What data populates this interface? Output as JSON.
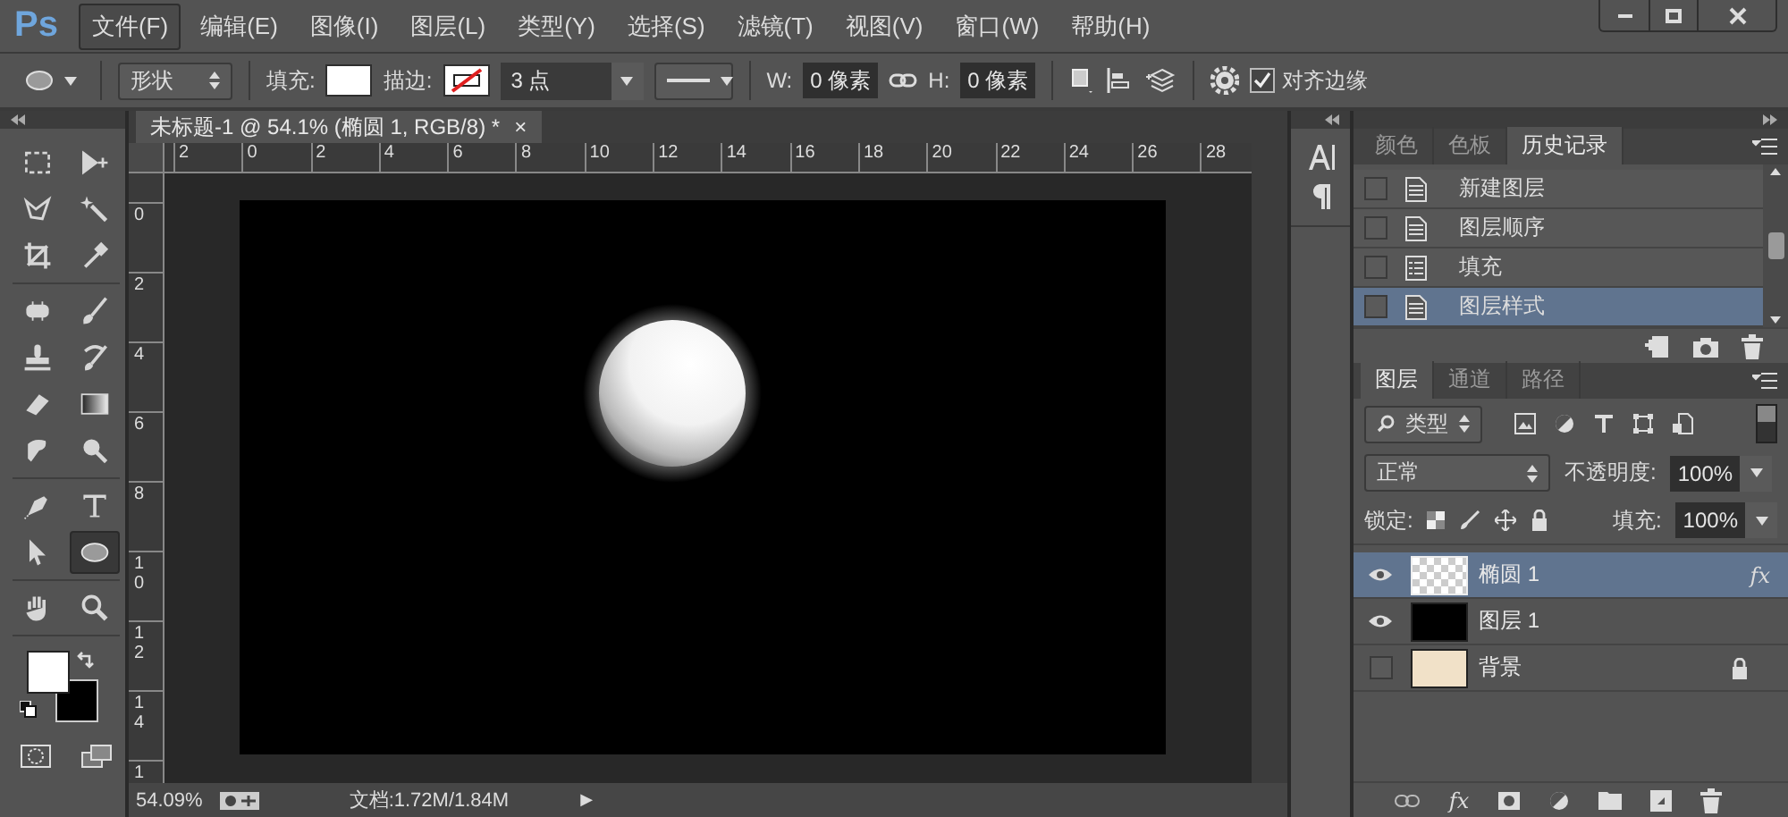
{
  "menu_bar": {
    "logo": "Ps",
    "items": [
      {
        "label": "文件(F)",
        "selected": true
      },
      {
        "label": "编辑(E)",
        "selected": false
      },
      {
        "label": "图像(I)",
        "selected": false
      },
      {
        "label": "图层(L)",
        "selected": false
      },
      {
        "label": "类型(Y)",
        "selected": false
      },
      {
        "label": "选择(S)",
        "selected": false
      },
      {
        "label": "滤镜(T)",
        "selected": false
      },
      {
        "label": "视图(V)",
        "selected": false
      },
      {
        "label": "窗口(W)",
        "selected": false
      },
      {
        "label": "帮助(H)",
        "selected": false
      }
    ]
  },
  "options_bar": {
    "mode": "形状",
    "fill_label": "填充:",
    "stroke_label": "描边:",
    "stroke_width": "3 点",
    "w_label": "W:",
    "w_value": "0 像素",
    "h_label": "H:",
    "h_value": "0 像素",
    "align_edges": {
      "label": "对齐边缘",
      "checked": true
    }
  },
  "toolbox": {
    "groups": [
      {
        "tools": [
          {
            "kind": "marquee",
            "selected": false
          },
          {
            "kind": "move",
            "selected": false
          },
          {
            "kind": "lasso",
            "selected": false
          },
          {
            "kind": "wand",
            "selected": false
          },
          {
            "kind": "crop",
            "selected": false
          },
          {
            "kind": "eyedropper",
            "selected": false
          }
        ]
      },
      {
        "tools": [
          {
            "kind": "healing",
            "selected": false
          },
          {
            "kind": "brush",
            "selected": false
          },
          {
            "kind": "stamp",
            "selected": false
          },
          {
            "kind": "history",
            "selected": false
          },
          {
            "kind": "eraser",
            "selected": false
          },
          {
            "kind": "gradient",
            "selected": false
          },
          {
            "kind": "smudge",
            "selected": false
          },
          {
            "kind": "dodge",
            "selected": false
          }
        ]
      },
      {
        "tools": [
          {
            "kind": "pen",
            "selected": false
          },
          {
            "kind": "type",
            "selected": false
          },
          {
            "kind": "select",
            "selected": false
          },
          {
            "kind": "ellipse",
            "selected": true
          }
        ]
      },
      {
        "tools": [
          {
            "kind": "hand",
            "selected": false
          },
          {
            "kind": "zoom",
            "selected": false
          }
        ]
      }
    ]
  },
  "document": {
    "title": "未标题-1 @ 54.1% (椭圆 1, RGB/8) *",
    "close": "×",
    "ruler_h": [
      "2",
      "0",
      "2",
      "4",
      "6",
      "8",
      "10",
      "12",
      "14",
      "16",
      "18",
      "20",
      "22",
      "24",
      "26",
      "28"
    ],
    "ruler_v": [
      "0",
      "2",
      "4",
      "6",
      "8",
      "10",
      "12",
      "14",
      "1"
    ],
    "zoom": "54.09%",
    "doc_info": "文档:1.72M/1.84M",
    "menu_arrow": "▶"
  },
  "history_panel": {
    "tabs": [
      {
        "label": "颜色",
        "selected": false
      },
      {
        "label": "色板",
        "selected": false
      },
      {
        "label": "历史记录",
        "selected": true
      }
    ],
    "items": [
      {
        "label": "新建图层",
        "kind": "document",
        "selected": false
      },
      {
        "label": "图层顺序",
        "kind": "document",
        "selected": false
      },
      {
        "label": "填充",
        "kind": "list",
        "selected": false
      },
      {
        "label": "图层样式",
        "kind": "document",
        "selected": true
      }
    ]
  },
  "layers_panel": {
    "tabs": [
      {
        "label": "图层",
        "selected": true
      },
      {
        "label": "通道",
        "selected": false
      },
      {
        "label": "路径",
        "selected": false
      }
    ],
    "filter": "类型",
    "blend_mode": "正常",
    "opacity_label": "不透明度:",
    "opacity": "100%",
    "lock_label": "锁定:",
    "fill_label": "填充:",
    "fill": "100%",
    "footer_fx": "fx",
    "layers": [
      {
        "name": "椭圆 1",
        "visible": true,
        "selected": true,
        "kind": "transparent",
        "effects": "fx",
        "locked": false
      },
      {
        "name": "图层 1",
        "visible": true,
        "selected": false,
        "kind": "black",
        "locked": false
      },
      {
        "name": "背景",
        "visible": false,
        "selected": false,
        "kind": "paper",
        "locked": true
      }
    ]
  }
}
